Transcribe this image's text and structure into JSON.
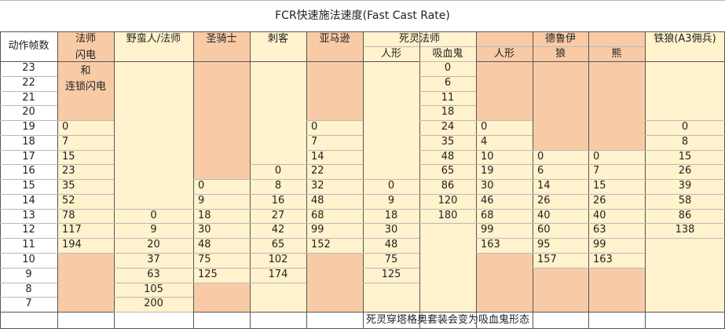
{
  "title": "FCR快速施法速度(Fast Cast Rate)",
  "colors": {
    "orange": "#f8cba6",
    "yellow": "#fff2cc",
    "white": "#ffffff"
  },
  "headers": {
    "frames": "动作帧数",
    "sorceress": "法师",
    "barbarian_caster": "野蛮人/法师",
    "paladin": "圣骑士",
    "assassin": "刺客",
    "amazon": "亚马逊",
    "necromancer": "死灵法师",
    "necromancer_human": "人形",
    "necromancer_vampire": "吸血鬼",
    "druid": "德鲁伊",
    "druid_human": "人形",
    "druid_wolf": "狼",
    "druid_bear": "熊",
    "iron_wolf": "铁狼(A3佣兵)"
  },
  "sorceress_note": [
    "闪电",
    "和",
    "连锁闪电"
  ],
  "frames": [
    "23",
    "22",
    "21",
    "20",
    "19",
    "18",
    "17",
    "16",
    "15",
    "14",
    "13",
    "12",
    "11",
    "10",
    "9",
    "8",
    "7"
  ],
  "columns": {
    "sorceress": [
      "",
      "",
      "",
      "",
      "0",
      "7",
      "15",
      "23",
      "35",
      "52",
      "78",
      "117",
      "194",
      "",
      "",
      "",
      ""
    ],
    "barbarian_caster": [
      "",
      "",
      "",
      "",
      "",
      "",
      "",
      "",
      "",
      "",
      "0",
      "9",
      "20",
      "37",
      "63",
      "105",
      "200"
    ],
    "paladin": [
      "",
      "",
      "",
      "",
      "",
      "",
      "",
      "",
      "0",
      "9",
      "18",
      "30",
      "48",
      "75",
      "125",
      "",
      ""
    ],
    "assassin": [
      "",
      "",
      "",
      "",
      "",
      "",
      "",
      "0",
      "8",
      "16",
      "27",
      "42",
      "65",
      "102",
      "174",
      "",
      ""
    ],
    "amazon": [
      "",
      "",
      "",
      "",
      "0",
      "7",
      "14",
      "22",
      "32",
      "48",
      "68",
      "99",
      "152",
      "",
      "",
      "",
      ""
    ],
    "necro_human": [
      "",
      "",
      "",
      "",
      "",
      "",
      "",
      "",
      "0",
      "9",
      "18",
      "30",
      "48",
      "75",
      "125",
      "",
      ""
    ],
    "necro_vampire": [
      "0",
      "6",
      "11",
      "18",
      "24",
      "35",
      "48",
      "65",
      "86",
      "120",
      "180",
      "",
      "",
      "",
      "",
      "",
      ""
    ],
    "druid_human": [
      "",
      "",
      "",
      "",
      "0",
      "4",
      "10",
      "19",
      "30",
      "46",
      "68",
      "99",
      "163",
      "",
      "",
      "",
      ""
    ],
    "druid_wolf": [
      "",
      "",
      "",
      "",
      "",
      "",
      "0",
      "6",
      "14",
      "26",
      "40",
      "60",
      "95",
      "157",
      "",
      "",
      ""
    ],
    "druid_bear": [
      "",
      "",
      "",
      "",
      "",
      "",
      "0",
      "7",
      "15",
      "26",
      "40",
      "63",
      "99",
      "163",
      "",
      "",
      ""
    ],
    "iron_wolf": [
      "",
      "",
      "",
      "",
      "0",
      "8",
      "15",
      "26",
      "39",
      "58",
      "86",
      "138",
      "",
      "",
      "",
      "",
      ""
    ]
  },
  "footnote": "死灵穿塔格奥套装会变为吸血鬼形态"
}
